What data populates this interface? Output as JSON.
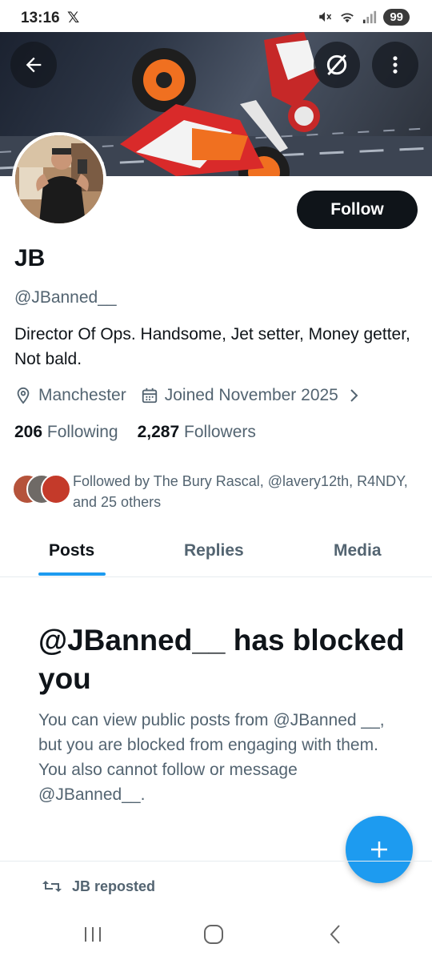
{
  "status_bar": {
    "time": "13:16",
    "app_icon": "x-logo",
    "battery": "99"
  },
  "header": {
    "back_icon": "arrow-left-icon",
    "grok_icon": "grok-icon",
    "more_icon": "more-vertical-icon"
  },
  "profile": {
    "name": "JB",
    "handle": "@JBanned__",
    "bio": "Director Of Ops. Handsome, Jet setter, Money getter, Not bald.",
    "location": "Manchester",
    "joined": "Joined November 2025",
    "following_count": "206",
    "following_label": "Following",
    "followers_count": "2,287",
    "followers_label": "Followers",
    "follow_button": "Follow",
    "followed_by": "Followed by The Bury Rascal, @lavery12th, R4NDY, and 25 others"
  },
  "tabs": [
    {
      "label": "Posts",
      "active": true
    },
    {
      "label": "Replies",
      "active": false
    },
    {
      "label": "Media",
      "active": false
    }
  ],
  "blocked": {
    "title": "@JBanned__ has blocked you",
    "message": "You can view public posts from @JBanned __, but you are blocked from engaging with them. You also cannot follow or message @JBanned__."
  },
  "repost_banner": {
    "label": "JB reposted"
  },
  "colors": {
    "accent": "#1d9bf0",
    "text_primary": "#0f1419",
    "text_secondary": "#536471",
    "follow_button_bg": "#0f1419"
  }
}
